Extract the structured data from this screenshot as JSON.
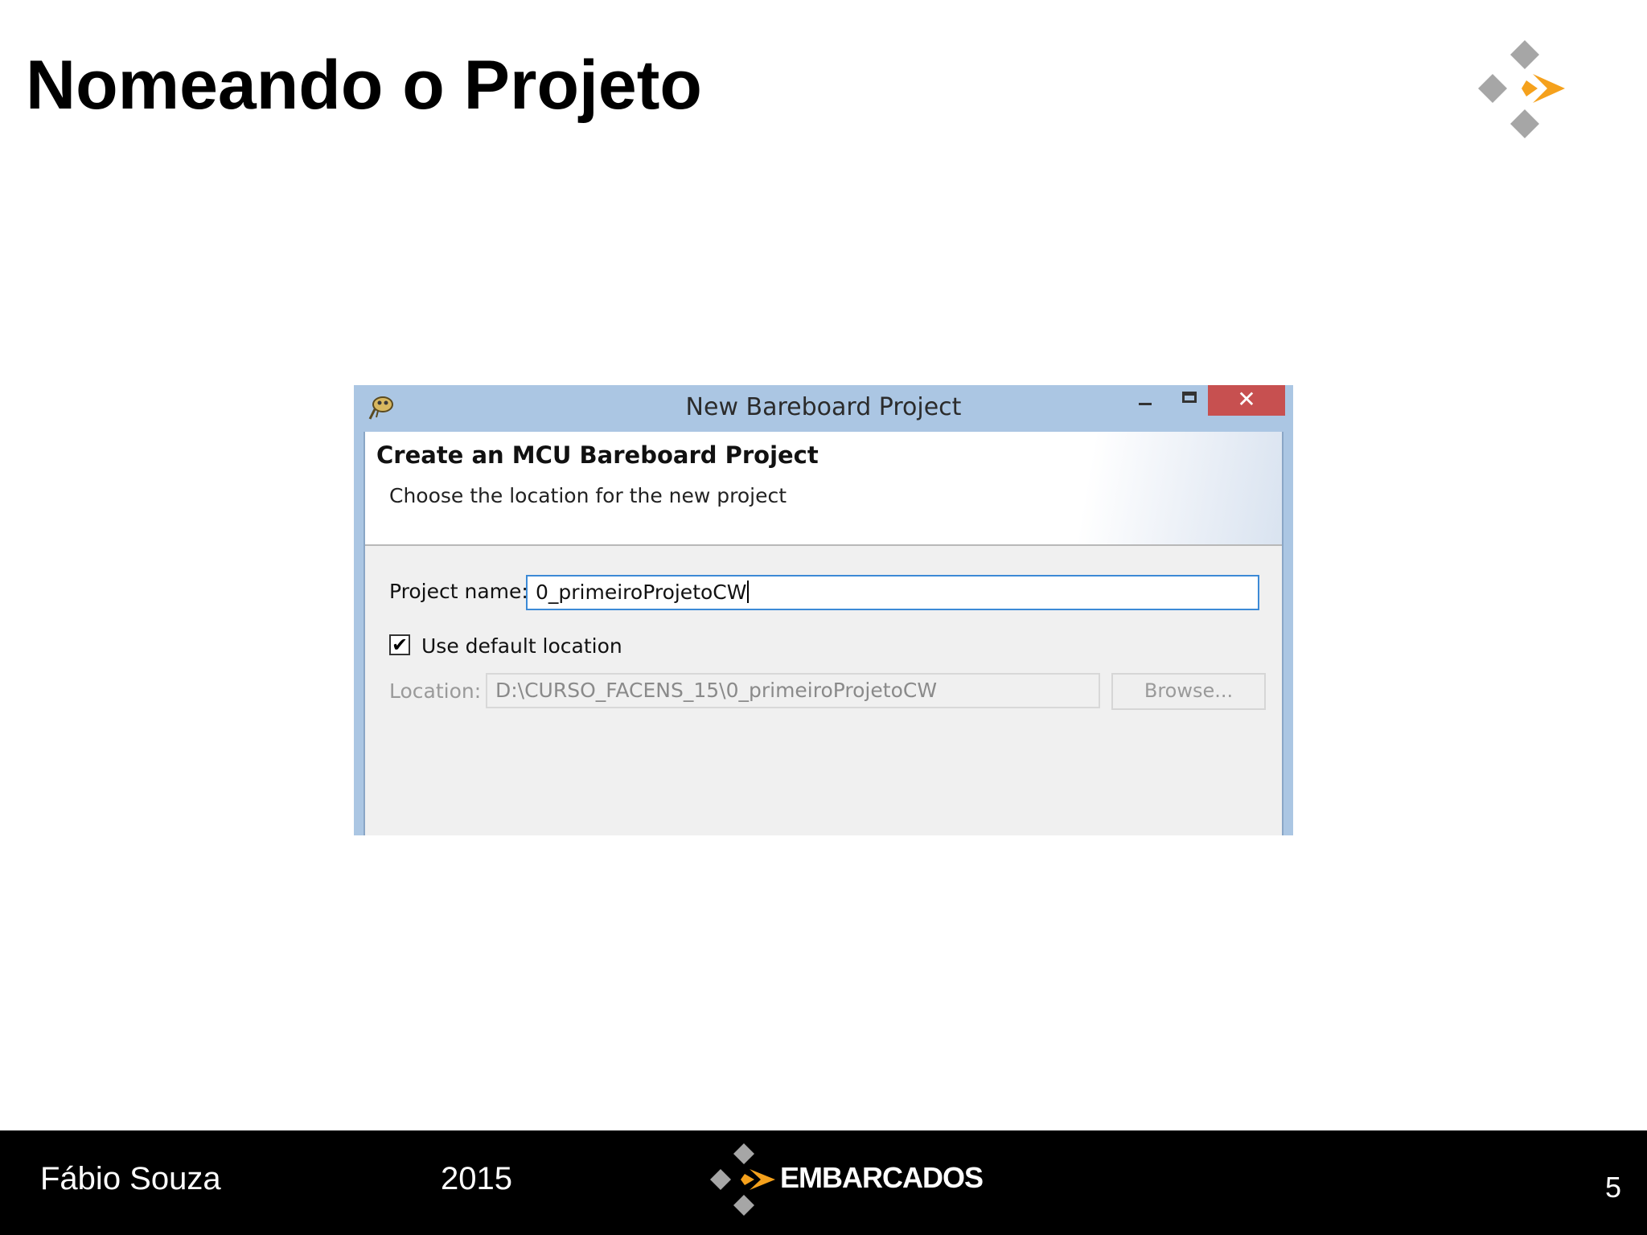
{
  "slide": {
    "title": "Nomeando o Projeto"
  },
  "dialog": {
    "window_title": "New Bareboard Project",
    "close_glyph": "✕",
    "header_title": "Create an MCU Bareboard Project",
    "header_subtitle": "Choose the location for the new project",
    "project_name_label": "Project name:",
    "project_name_value": "0_primeiroProjetoCW",
    "use_default_location_checked": true,
    "check_glyph": "✔",
    "use_default_location_label": "Use default location",
    "location_label": "Location:",
    "location_value": "D:\\CURSO_FACENS_15\\0_primeiroProjetoCW",
    "browse_label": "Browse..."
  },
  "footer": {
    "author": "Fábio Souza",
    "year": "2015",
    "brand": "EMBARCADOS",
    "page_number": "5"
  },
  "colors": {
    "logo_gray": "#a6a6a6",
    "logo_orange": "#f5a11c",
    "titlebar_blue": "#abc6e3",
    "close_red": "#c75050",
    "input_focus_blue": "#3c8ad6"
  }
}
